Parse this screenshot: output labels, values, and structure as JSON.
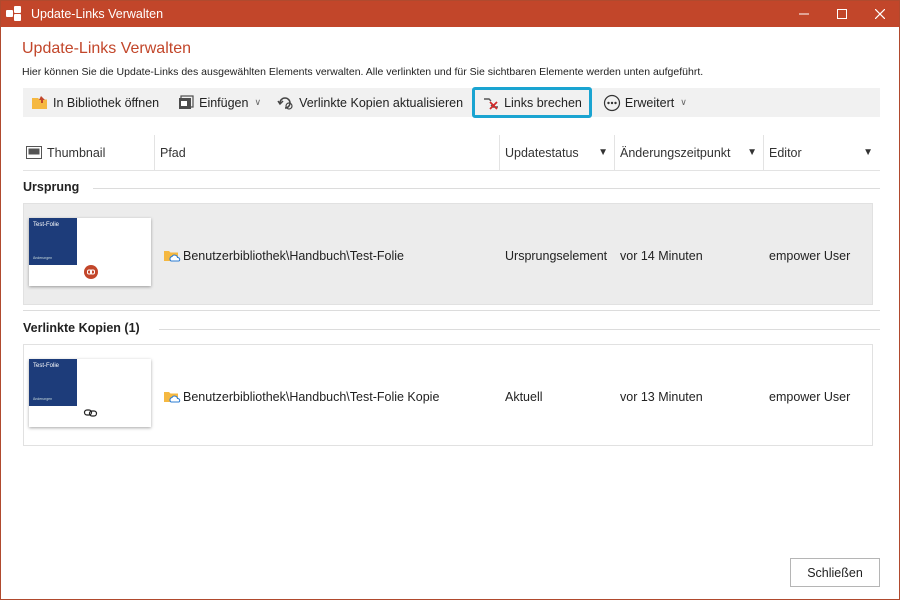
{
  "window": {
    "title": "Update-Links Verwalten"
  },
  "dialog": {
    "heading": "Update-Links Verwalten",
    "description": "Hier können Sie die Update-Links des ausgewählten Elements verwalten. Alle verlinkten und für Sie sichtbaren Elemente werden unten aufgeführt."
  },
  "toolbar": {
    "open_library": "In Bibliothek öffnen",
    "insert": "Einfügen",
    "update_copies": "Verlinkte Kopien aktualisieren",
    "break_links": "Links brechen",
    "advanced": "Erweitert"
  },
  "columns": {
    "thumbnail": "Thumbnail",
    "path": "Pfad",
    "status": "Updatestatus",
    "changed": "Änderungszeitpunkt",
    "editor": "Editor"
  },
  "sections": {
    "origin": "Ursprung",
    "copies": "Verlinkte Kopien (1)"
  },
  "rows": [
    {
      "thumb_title": "Test-Folie",
      "thumb_sub": "Änderungen",
      "path": "Benutzerbibliothek\\Handbuch\\Test-Folie",
      "status": "Ursprungselement",
      "changed": "vor 14 Minuten",
      "editor": "empower User"
    },
    {
      "thumb_title": "Test-Folie",
      "thumb_sub": "Änderungen",
      "path": "Benutzerbibliothek\\Handbuch\\Test-Folie Kopie",
      "status": "Aktuell",
      "changed": "vor 13 Minuten",
      "editor": "empower User"
    }
  ],
  "footer": {
    "close": "Schließen"
  },
  "colors": {
    "accent": "#c2462a",
    "highlight": "#1aa4d1",
    "thumb_blue": "#1d3c7a"
  }
}
